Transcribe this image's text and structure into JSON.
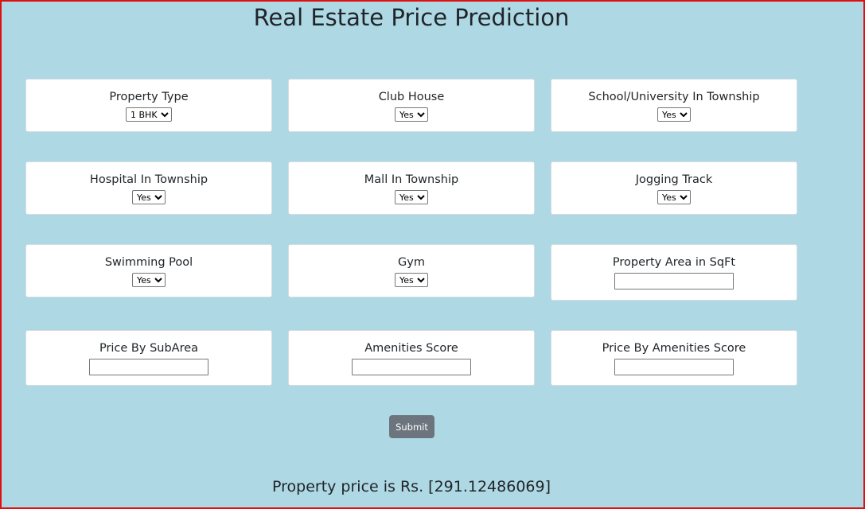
{
  "page": {
    "title": "Real Estate Price Prediction"
  },
  "fields": {
    "property_type": {
      "label": "Property Type",
      "value": "1 BHK"
    },
    "club_house": {
      "label": "Club House",
      "value": "Yes"
    },
    "school_university": {
      "label": "School/University In Township",
      "value": "Yes"
    },
    "hospital": {
      "label": "Hospital In Township",
      "value": "Yes"
    },
    "mall": {
      "label": "Mall In Township",
      "value": "Yes"
    },
    "jogging_track": {
      "label": "Jogging Track",
      "value": "Yes"
    },
    "swimming_pool": {
      "label": "Swimming Pool",
      "value": "Yes"
    },
    "gym": {
      "label": "Gym",
      "value": "Yes"
    },
    "property_area": {
      "label": "Property Area in SqFt",
      "value": ""
    },
    "price_by_subarea": {
      "label": "Price By SubArea",
      "value": ""
    },
    "amenities_score": {
      "label": "Amenities Score",
      "value": ""
    },
    "price_by_amenities": {
      "label": "Price By Amenities Score",
      "value": ""
    }
  },
  "submit_label": "Submit",
  "result_text": "Property price is Rs. [291.12486069]",
  "colors": {
    "background": "#add8e4",
    "border": "#e01010",
    "button": "#6c757d"
  }
}
